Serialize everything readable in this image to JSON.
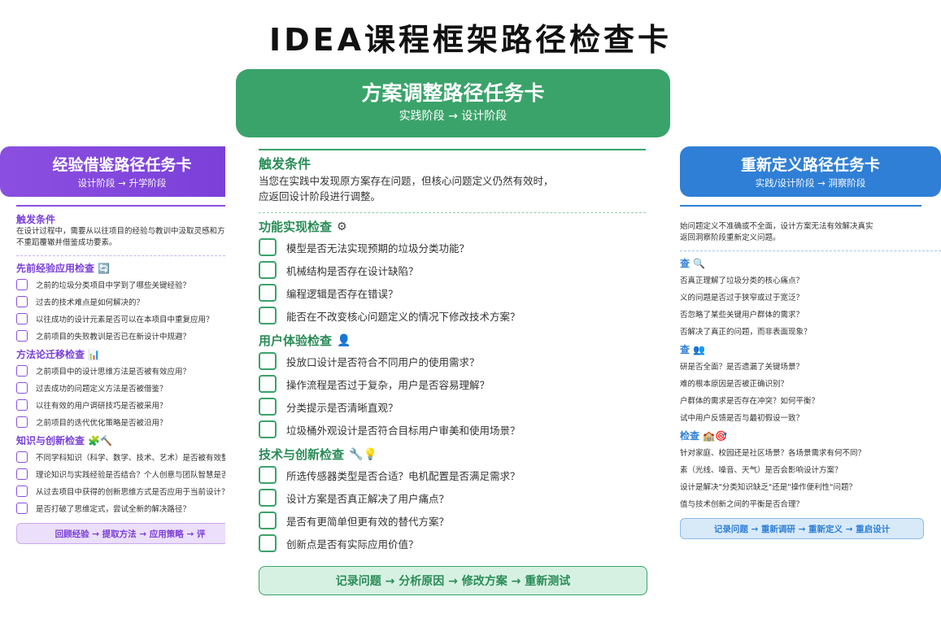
{
  "page": {
    "title": "IDEA课程框架路径检查卡"
  },
  "left_card": {
    "title": "经验借鉴路径任务卡",
    "subtitle": "设计阶段 → 升学阶段",
    "trigger_heading": "触发条件",
    "trigger_text_1": "在设计过程中，需要从以往项目的经验与教训中汲取灵感和方",
    "trigger_text_2": "不重蹈覆辙并借鉴成功要素。",
    "sections": [
      {
        "title": "先前经验应用检查",
        "icon": "🔄",
        "items": [
          "之前的垃圾分类项目中学到了哪些关键经验？",
          "过去的技术难点是如何解决的？",
          "以往成功的设计元素是否可以在本项目中重复应用？",
          "之前项目的失败教训是否已在新设计中规避？"
        ]
      },
      {
        "title": "方法论迁移检查",
        "icon": "📊",
        "items": [
          "之前项目中的设计思维方法是否被有效应用？",
          "过去成功的问题定义方法是否被借鉴？",
          "以往有效的用户调研技巧是否被采用？",
          "之前项目的迭代优化策略是否被沿用？"
        ]
      },
      {
        "title": "知识与创新检查",
        "icon": "🧩🔨",
        "items": [
          "不同学科知识（科学、数学、技术、艺术）是否被有效整",
          "理论知识与实践经验是否结合？个人创意与团队智慧是否",
          "从过去项目中获得的创新思维方式是否应用于当前设计？",
          "是否打破了思维定式，尝试全新的解决路径？"
        ]
      }
    ],
    "footer": "回顾经验 → 提取方法 → 应用策略 → 评"
  },
  "center_card": {
    "title": "方案调整路径任务卡",
    "subtitle": "实践阶段 → 设计阶段",
    "trigger_heading": "触发条件",
    "trigger_text_1": "当您在实践中发现原方案存在问题，但核心问题定义仍然有效时，",
    "trigger_text_2": "应返回设计阶段进行调整。",
    "sections": [
      {
        "title": "功能实现检查",
        "icon": "⚙",
        "items": [
          "模型是否无法实现预期的垃圾分类功能？",
          "机械结构是否存在设计缺陷？",
          "编程逻辑是否存在错误？",
          "能否在不改变核心问题定义的情况下修改技术方案？"
        ]
      },
      {
        "title": "用户体验检查",
        "icon": "👤",
        "items": [
          "投放口设计是否符合不同用户的使用需求？",
          "操作流程是否过于复杂，用户是否容易理解？",
          "分类提示是否清晰直观？",
          "垃圾桶外观设计是否符合目标用户审美和使用场景？"
        ]
      },
      {
        "title": "技术与创新检查",
        "icon": "🔧💡",
        "items": [
          "所选传感器类型是否合适？电机配置是否满足需求？",
          "设计方案是否真正解决了用户痛点？",
          "是否有更简单但更有效的替代方案？",
          "创新点是否有实际应用价值？"
        ]
      }
    ],
    "footer": "记录问题 → 分析原因 → 修改方案 → 重新测试"
  },
  "right_card": {
    "title": "重新定义路径任务卡",
    "subtitle": "实践/设计阶段 → 洞察阶段",
    "trigger_text_1": "始问题定义不准确或不全面，设计方案无法有效解决真实",
    "trigger_text_2": "返回洞察阶段重新定义问题。",
    "sections": [
      {
        "title": "查",
        "icon": "🔍",
        "items": [
          "否真正理解了垃圾分类的核心痛点？",
          "义的问题是否过于狭窄或过于宽泛？",
          "否忽略了某些关键用户群体的需求？",
          "否解决了真正的问题，而非表面现象？"
        ]
      },
      {
        "title": "查",
        "icon": "👥",
        "items": [
          "研是否全面？是否遗漏了关键场景？",
          "难的根本原因是否被正确识别？",
          "户群体的需求是否存在冲突？如何平衡？",
          "试中用户反馈是否与最初假设一致？"
        ]
      },
      {
        "title": "检查",
        "icon": "🏫🎯",
        "items": [
          "针对家庭、校园还是社区场景？各场景需求有何不同？",
          "素（光线、噪音、天气）是否会影响设计方案？",
          "设计是解决\"分类知识缺乏\"还是\"操作便利性\"问题？",
          "值与技术创新之间的平衡是否合理？"
        ]
      }
    ],
    "footer": "记录问题 → 重新调研 → 重新定义 → 重启设计"
  }
}
